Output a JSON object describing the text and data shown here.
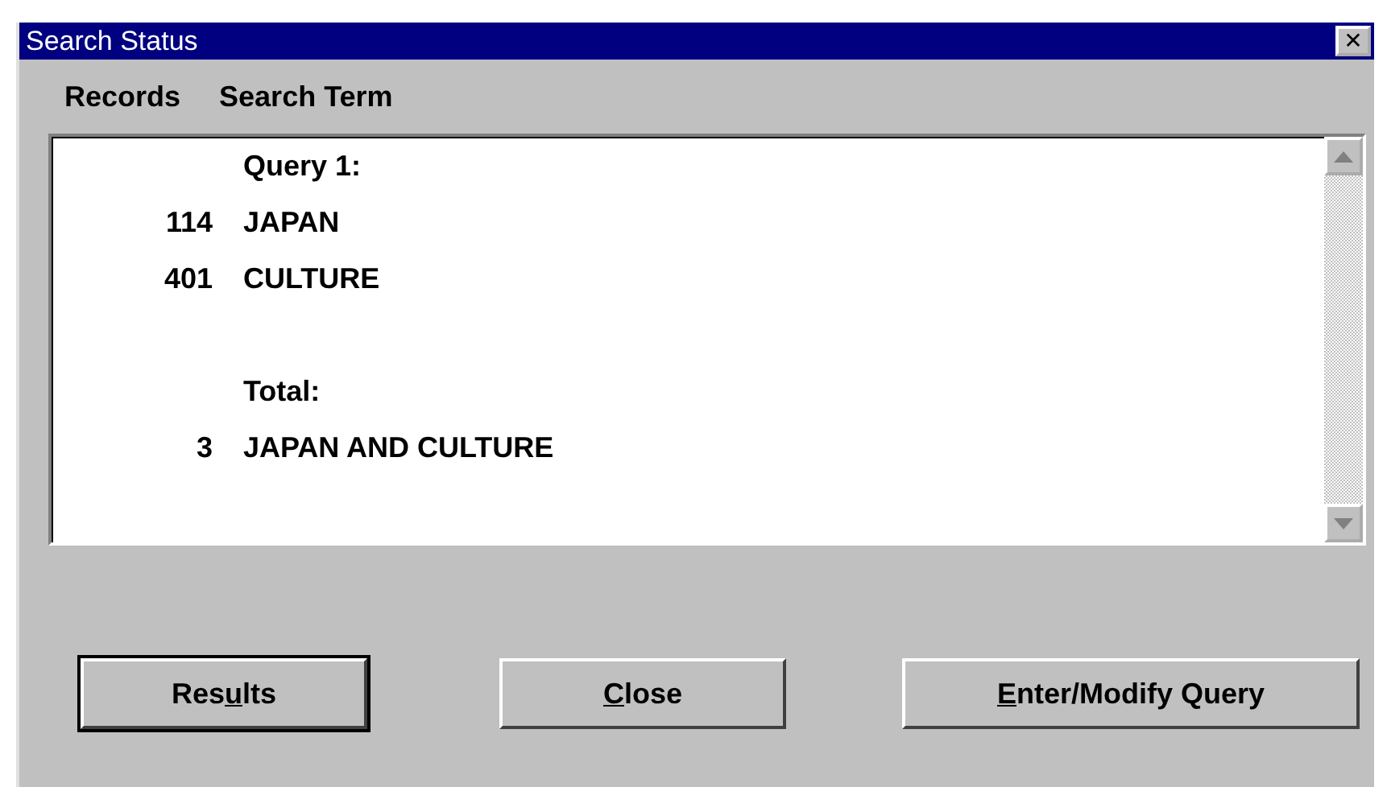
{
  "window": {
    "title": "Search Status",
    "close_glyph": "✕"
  },
  "columns": [
    "Records",
    "Search Term"
  ],
  "rows": [
    {
      "kind": "label",
      "term": "Query 1:"
    },
    {
      "kind": "count",
      "records": "114",
      "term": "JAPAN"
    },
    {
      "kind": "count",
      "records": "401",
      "term": "CULTURE"
    },
    {
      "kind": "blank"
    },
    {
      "kind": "label",
      "term": "Total:"
    },
    {
      "kind": "count",
      "records": "3",
      "term": "JAPAN AND CULTURE"
    }
  ],
  "buttons": [
    {
      "before": "Res",
      "key": "u",
      "after": "lts",
      "default": true
    },
    {
      "key": "C",
      "after": "lose",
      "default": false
    },
    {
      "key": "E",
      "after": "nter/Modify Query",
      "default": false
    }
  ]
}
